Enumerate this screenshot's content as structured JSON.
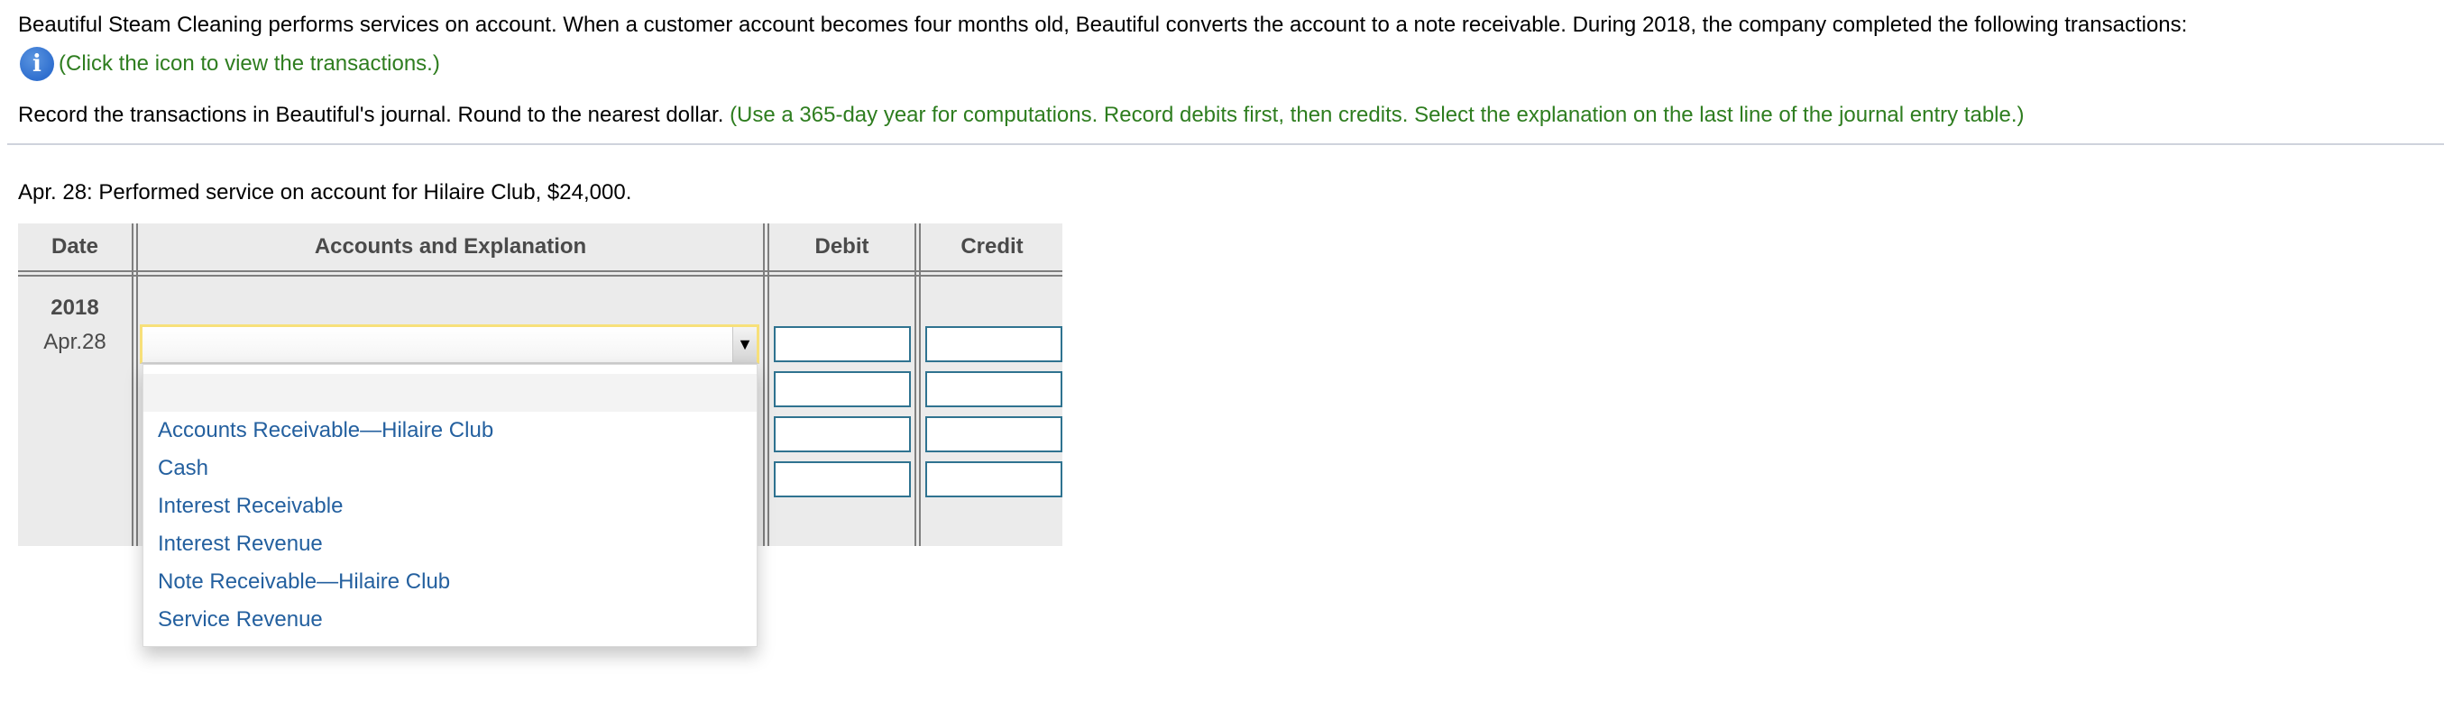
{
  "problem": {
    "intro": "Beautiful Steam Cleaning performs services on account. When a customer account becomes four months old, Beautiful converts the account to a note receivable. During 2018, the company completed the following transactions:",
    "info_icon": "info-icon",
    "info_link": "(Click the icon to view the transactions.)",
    "instruction_main": "Record the transactions in Beautiful's journal. Round to the nearest dollar.",
    "instruction_note": "(Use a 365-day year for computations. Record debits first, then credits. Select the explanation on the last line of the journal entry table.)",
    "transaction": "Apr. 28: Performed service on account for Hilaire Club, $24,000."
  },
  "journal": {
    "headers": {
      "date": "Date",
      "accounts": "Accounts and Explanation",
      "debit": "Debit",
      "credit": "Credit"
    },
    "year": "2018",
    "entry_date": "Apr.28",
    "selected_account": "",
    "dropdown_arrow": "▼",
    "rows": [
      {
        "debit": "",
        "credit": ""
      },
      {
        "debit": "",
        "credit": ""
      },
      {
        "debit": "",
        "credit": ""
      },
      {
        "debit": "",
        "credit": ""
      }
    ],
    "account_options": [
      "",
      "Accounts Receivable—Hilaire Club",
      "Cash",
      "Interest Receivable",
      "Interest Revenue",
      "Note Receivable—Hilaire Club",
      "Service Revenue"
    ]
  },
  "colors": {
    "instruction_green": "#2e7d1f",
    "option_blue": "#24609f",
    "input_border": "#2f7390",
    "focus_yellow": "#f7e07a",
    "table_bg": "#ebebeb"
  }
}
